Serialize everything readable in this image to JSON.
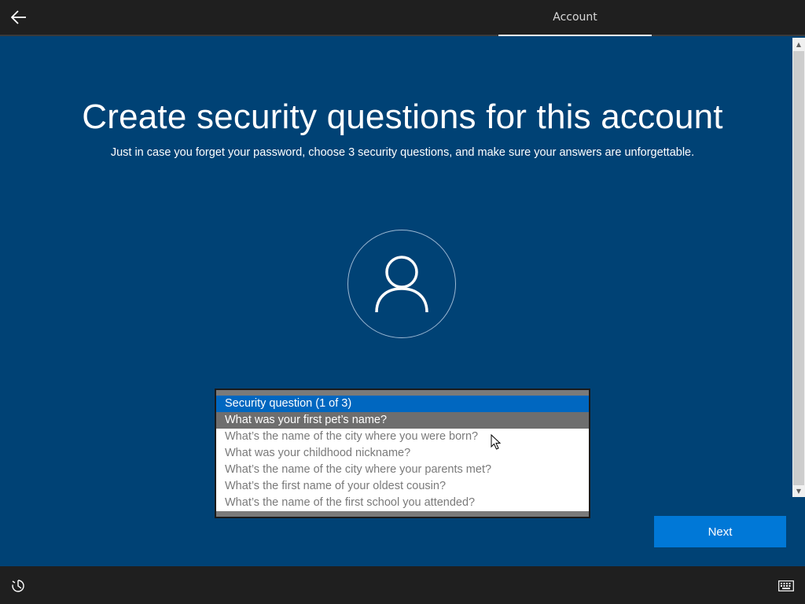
{
  "header": {
    "tab_label": "Account",
    "back_icon": "arrow-left-icon"
  },
  "main": {
    "title": "Create security questions for this account",
    "subtitle": "Just in case you forget your password, choose 3 security questions, and make sure your answers are unforgettable.",
    "avatar_icon": "user-icon"
  },
  "dropdown": {
    "options": [
      "Security question (1 of 3)",
      "What was your first pet’s name?",
      "What’s the name of the city where you were born?",
      "What was your childhood nickname?",
      "What’s the name of the city where your parents met?",
      "What’s the first name of your oldest cousin?",
      "What’s the name of the first school you attended?"
    ],
    "selected_index": 0,
    "hover_index": 1
  },
  "next_button": {
    "label": "Next"
  },
  "footer": {
    "accessibility_icon": "ease-of-access-icon",
    "keyboard_icon": "keyboard-icon"
  },
  "colors": {
    "background": "#004275",
    "accent": "#0078d7",
    "selected": "#0067c0",
    "bar": "#1f1f1f"
  }
}
